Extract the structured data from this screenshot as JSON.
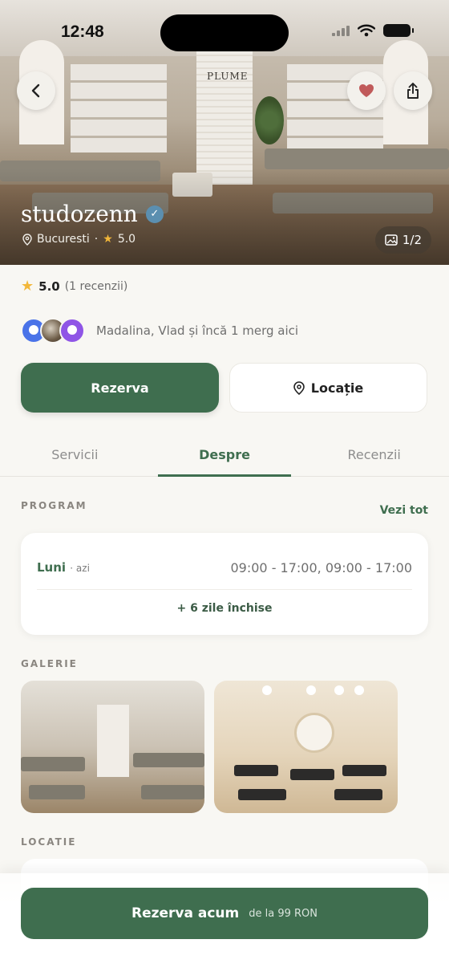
{
  "status_bar": {
    "time": "12:48"
  },
  "hero": {
    "studio_name": "studozenn",
    "location": "Bucuresti",
    "separator": "·",
    "rating": "5.0",
    "image_counter": "1/2",
    "logo_text": "PLUME"
  },
  "rating": {
    "score": "5.0",
    "count": "(1 recenzii)"
  },
  "friends": {
    "text": "Madalina, Vlad și încă 1 merg aici"
  },
  "actions": {
    "book": "Rezerva",
    "location": "Locație"
  },
  "tabs": [
    {
      "label": "Servicii"
    },
    {
      "label": "Despre"
    },
    {
      "label": "Recenzii"
    }
  ],
  "program": {
    "section_label": "PROGRAM",
    "see_all": "Vezi tot",
    "day": "Luni",
    "day_note": "· azi",
    "hours": "09:00 - 17:00, 09:00 - 17:00",
    "closed_days": "+ 6 zile închise"
  },
  "gallery": {
    "section_label": "GALERIE"
  },
  "location": {
    "section_label": "LOCATIE"
  },
  "cta": {
    "main": "Rezerva acum",
    "sub": "de la 99 RON"
  },
  "colors": {
    "primary": "#3f6e4f",
    "star": "#f2b73a",
    "background": "#f8f7f3",
    "verified": "#5b8fb0"
  }
}
